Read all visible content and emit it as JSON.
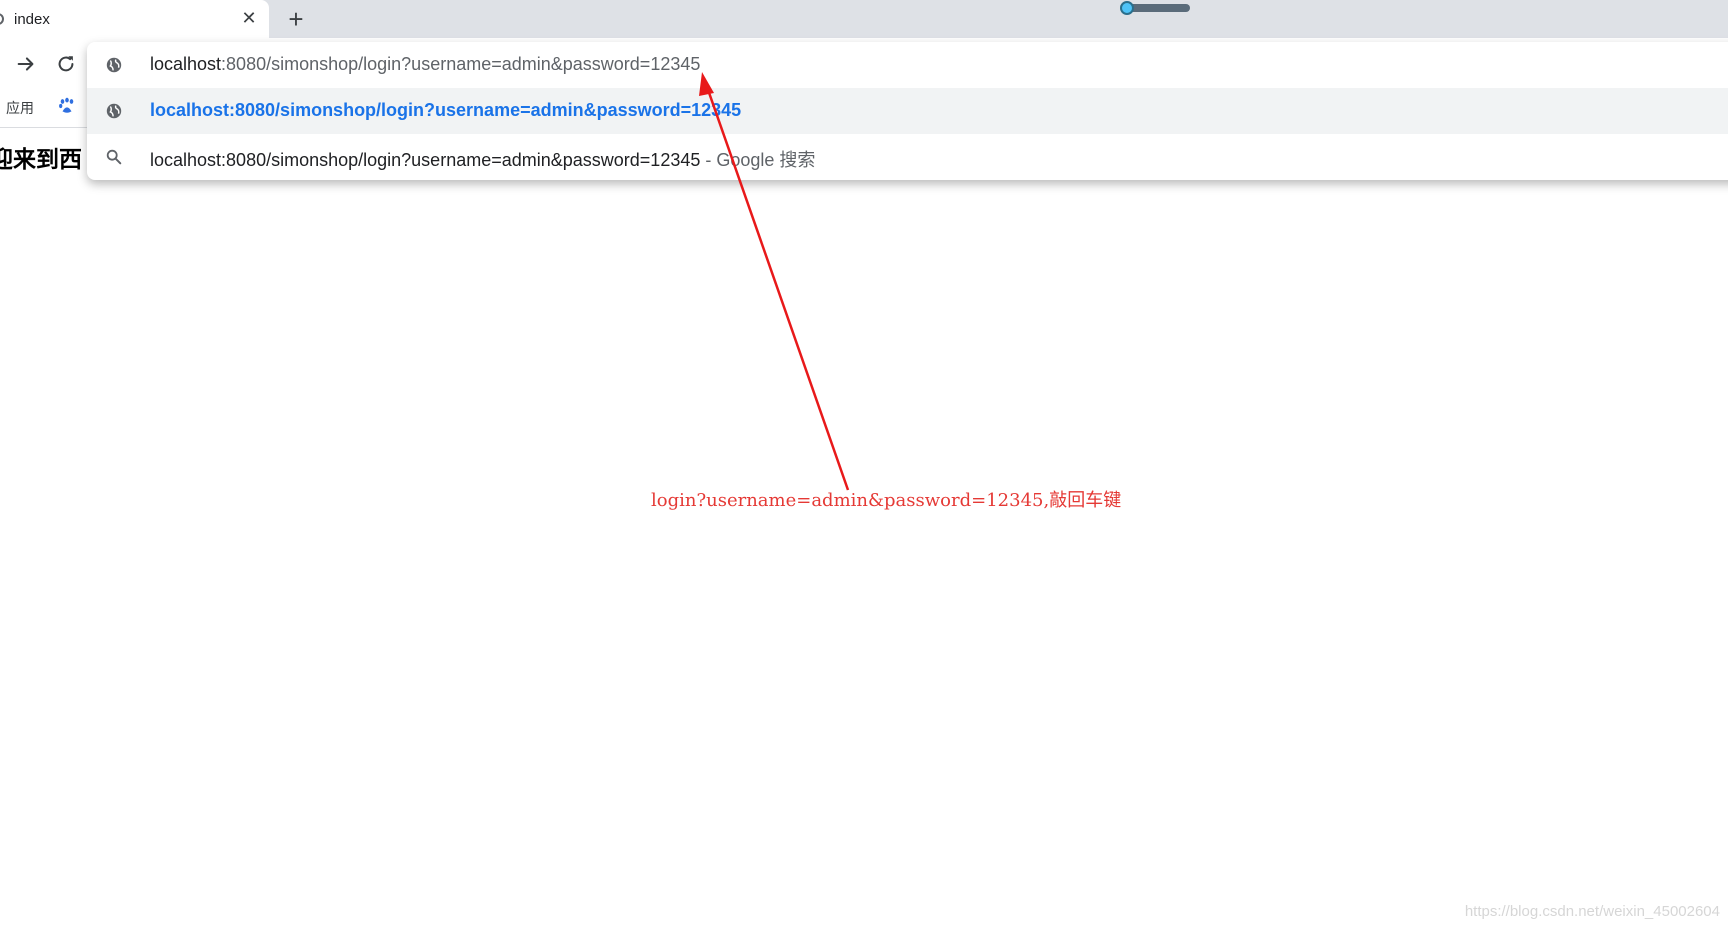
{
  "tab": {
    "title": "index",
    "close_glyph": "✕",
    "new_tab_glyph": "+"
  },
  "zoom_slider": {
    "level": 0.05
  },
  "bookmarks": {
    "apps_label": "应用",
    "paw_icon": "baidu-paw-icon"
  },
  "page": {
    "heading": "迎来到西"
  },
  "omnibox": {
    "input": {
      "host": "localhost",
      "rest": ":8080/simonshop/login?username=admin&password=12345"
    },
    "suggestions": [
      {
        "icon": "globe-icon",
        "text": "localhost:8080/simonshop/login?username=admin&password=12345"
      },
      {
        "icon": "search-icon",
        "text": "localhost:8080/simonshop/login?username=admin&password=12345",
        "suffix": " - Google 搜索"
      }
    ]
  },
  "annotation": {
    "text": "login?username=admin&password=12345,敲回车键",
    "color": "#e53935"
  },
  "watermark": "https://blog.csdn.net/weixin_45002604",
  "colors": {
    "accent_link": "#1a73e8",
    "tabstrip": "#dee1e6",
    "selected_row": "#f1f3f4"
  }
}
